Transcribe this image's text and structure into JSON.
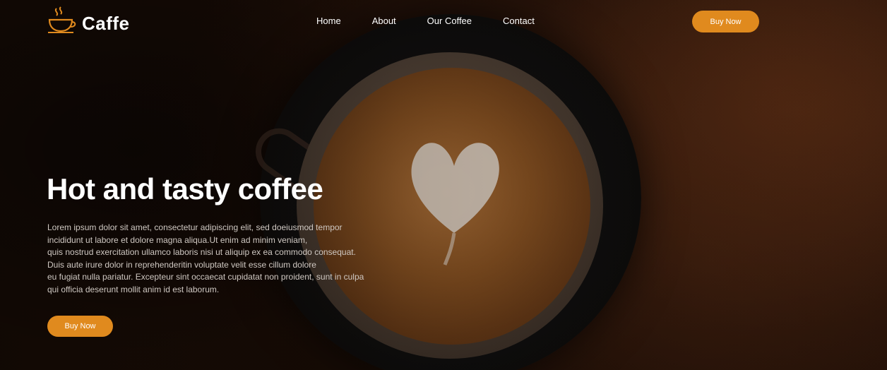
{
  "brand": {
    "name": "Caffe",
    "accent": "#e08a1e"
  },
  "nav": {
    "items": [
      {
        "label": "Home"
      },
      {
        "label": "About"
      },
      {
        "label": "Our Coffee"
      },
      {
        "label": "Contact"
      }
    ],
    "buy_label": "Buy Now"
  },
  "hero": {
    "title": "Hot and tasty coffee",
    "paragraph_lines": [
      "Lorem ipsum dolor sit amet, consectetur adipiscing elit, sed doeiusmod tempor",
      "incididunt ut labore et dolore magna aliqua.Ut enim ad minim veniam,",
      "quis nostrud exercitation ullamco laboris nisi ut aliquip ex ea commodo consequat.",
      "Duis aute irure dolor in reprehenderitin voluptate velit esse cillum dolore",
      "eu fugiat nulla pariatur. Excepteur sint occaecat cupidatat non proident, sunt in culpa",
      "qui officia deserunt mollit anim id est laborum."
    ],
    "buy_label": "Buy Now"
  },
  "icons": {
    "logo": "coffee-cup-icon"
  }
}
